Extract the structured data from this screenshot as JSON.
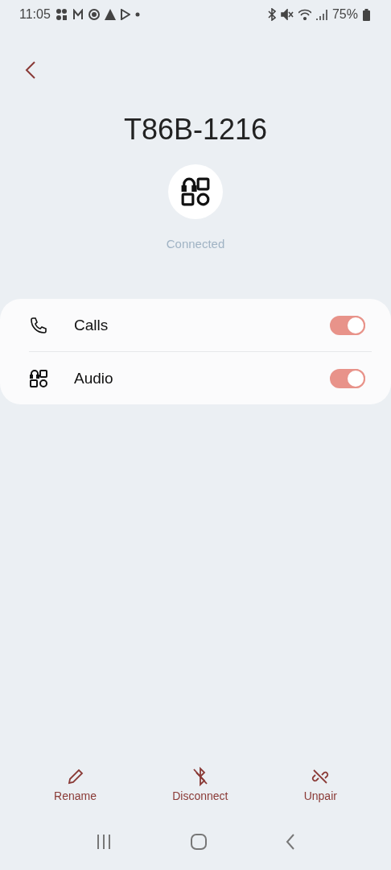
{
  "status_bar": {
    "time": "11:05",
    "battery": "75%"
  },
  "device": {
    "name": "T86B-1216",
    "status": "Connected"
  },
  "settings": [
    {
      "kind": "calls",
      "label": "Calls",
      "on": true
    },
    {
      "kind": "audio",
      "label": "Audio",
      "on": true
    }
  ],
  "actions": [
    {
      "kind": "rename",
      "label": "Rename"
    },
    {
      "kind": "disconnect",
      "label": "Disconnect"
    },
    {
      "kind": "unpair",
      "label": "Unpair"
    }
  ]
}
